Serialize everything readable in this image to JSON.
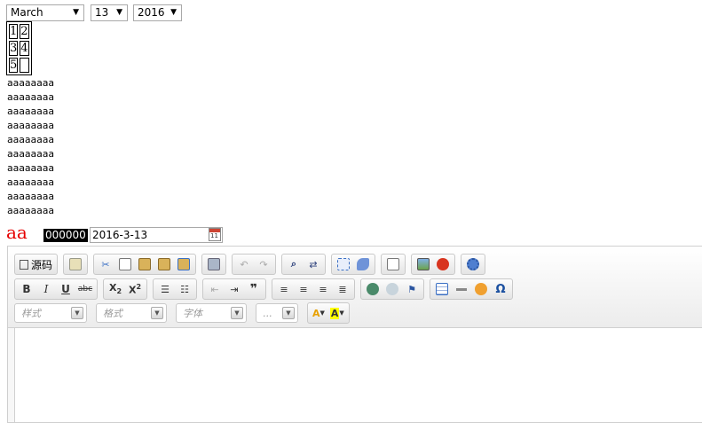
{
  "date_selects": {
    "month": "March",
    "day": "13",
    "year": "2016"
  },
  "grid": [
    [
      "1",
      "2"
    ],
    [
      "3",
      "4"
    ],
    [
      "5",
      ""
    ]
  ],
  "text_lines": [
    "aaaaaaaa",
    "aaaaaaaa",
    "aaaaaaaa",
    "aaaaaaaa",
    "aaaaaaaa",
    "aaaaaaaa",
    "aaaaaaaa",
    "aaaaaaaa",
    "aaaaaaaa",
    "aaaaaaaa"
  ],
  "styled_text": {
    "label": "aa",
    "color_code": "000000",
    "date_value": "2016-3-13"
  },
  "editor": {
    "source_label": "源码",
    "combos": {
      "style": "样式",
      "format": "格式",
      "font": "字体",
      "size": "..."
    },
    "colors": {
      "accent": "#1a4fa0",
      "text_color_icon": "#e8a000",
      "bg_color_icon": "#ffff00",
      "red_text": "#e60000"
    }
  }
}
